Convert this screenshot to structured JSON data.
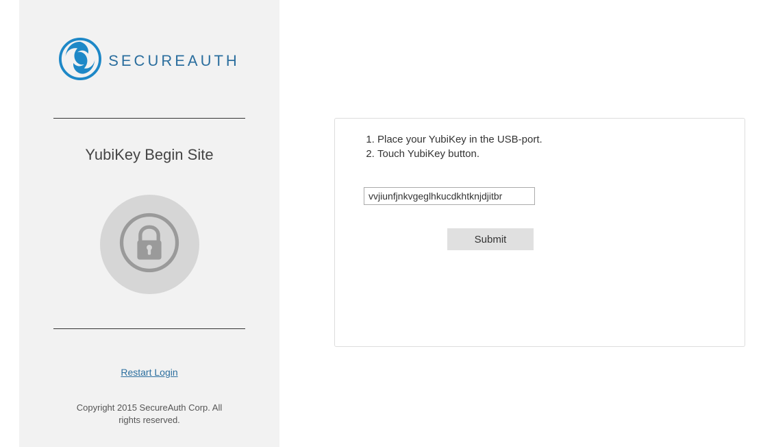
{
  "brand": {
    "name_left": "SECURE",
    "name_right": "AUTH"
  },
  "sidebar": {
    "title": "YubiKey Begin Site",
    "restart_label": "Restart Login",
    "copyright": "Copyright 2015 SecureAuth Corp. All rights reserved."
  },
  "main": {
    "instructions": [
      "Place your YubiKey in the USB-port.",
      "Touch YubiKey button."
    ],
    "input_value": "vvjiunfjnkvgeglhkucdkhtknjdjitbr",
    "submit_label": "Submit"
  },
  "colors": {
    "brand_blue": "#1e88c7",
    "sidebar_bg": "#f2f2f2",
    "lock_gray": "#9a9a9a",
    "button_bg": "#e0e0e0"
  }
}
